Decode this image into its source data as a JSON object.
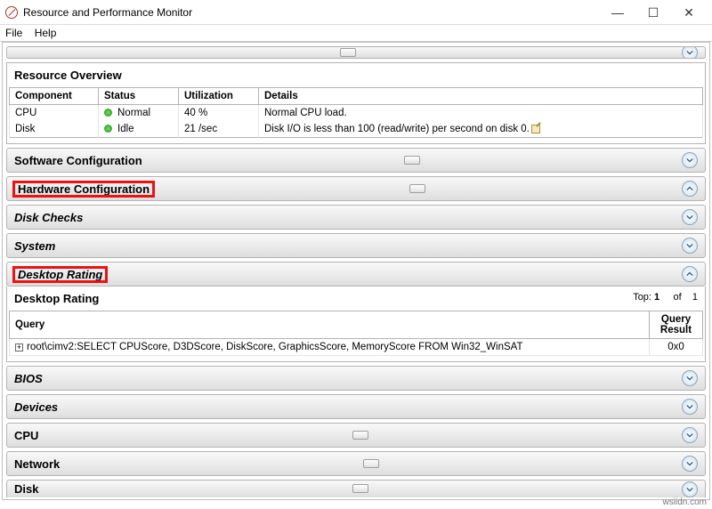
{
  "window": {
    "title": "Resource and Performance Monitor"
  },
  "menu": {
    "file": "File",
    "help": "Help"
  },
  "truncated_top_label": "",
  "overview": {
    "title": "Resource Overview",
    "headers": {
      "component": "Component",
      "status": "Status",
      "utilization": "Utilization",
      "details": "Details"
    },
    "rows": [
      {
        "component": "CPU",
        "status": "Normal",
        "util": "40 %",
        "details": "Normal CPU load."
      },
      {
        "component": "Disk",
        "status": "Idle",
        "util": "21 /sec",
        "details": "Disk I/O is less than 100 (read/write) per second on disk 0."
      }
    ]
  },
  "sections": {
    "software": "Software Configuration",
    "hardware": "Hardware Configuration",
    "diskchecks": "Disk Checks",
    "system": "System",
    "desktoprating_hdr": "Desktop Rating"
  },
  "desktop_rating": {
    "title": "Desktop Rating",
    "pager_top": "Top:",
    "pager_topval": "1",
    "pager_of": "of",
    "pager_total": "1",
    "col_query": "Query",
    "col_result": "Query Result",
    "row_query": "root\\cimv2:SELECT CPUScore, D3DScore, DiskScore, GraphicsScore, MemoryScore FROM Win32_WinSAT",
    "row_result": "0x0"
  },
  "sections2": {
    "bios": "BIOS",
    "devices": "Devices",
    "cpu": "CPU",
    "network": "Network",
    "disk": "Disk"
  },
  "watermark": "wsiidn.com"
}
